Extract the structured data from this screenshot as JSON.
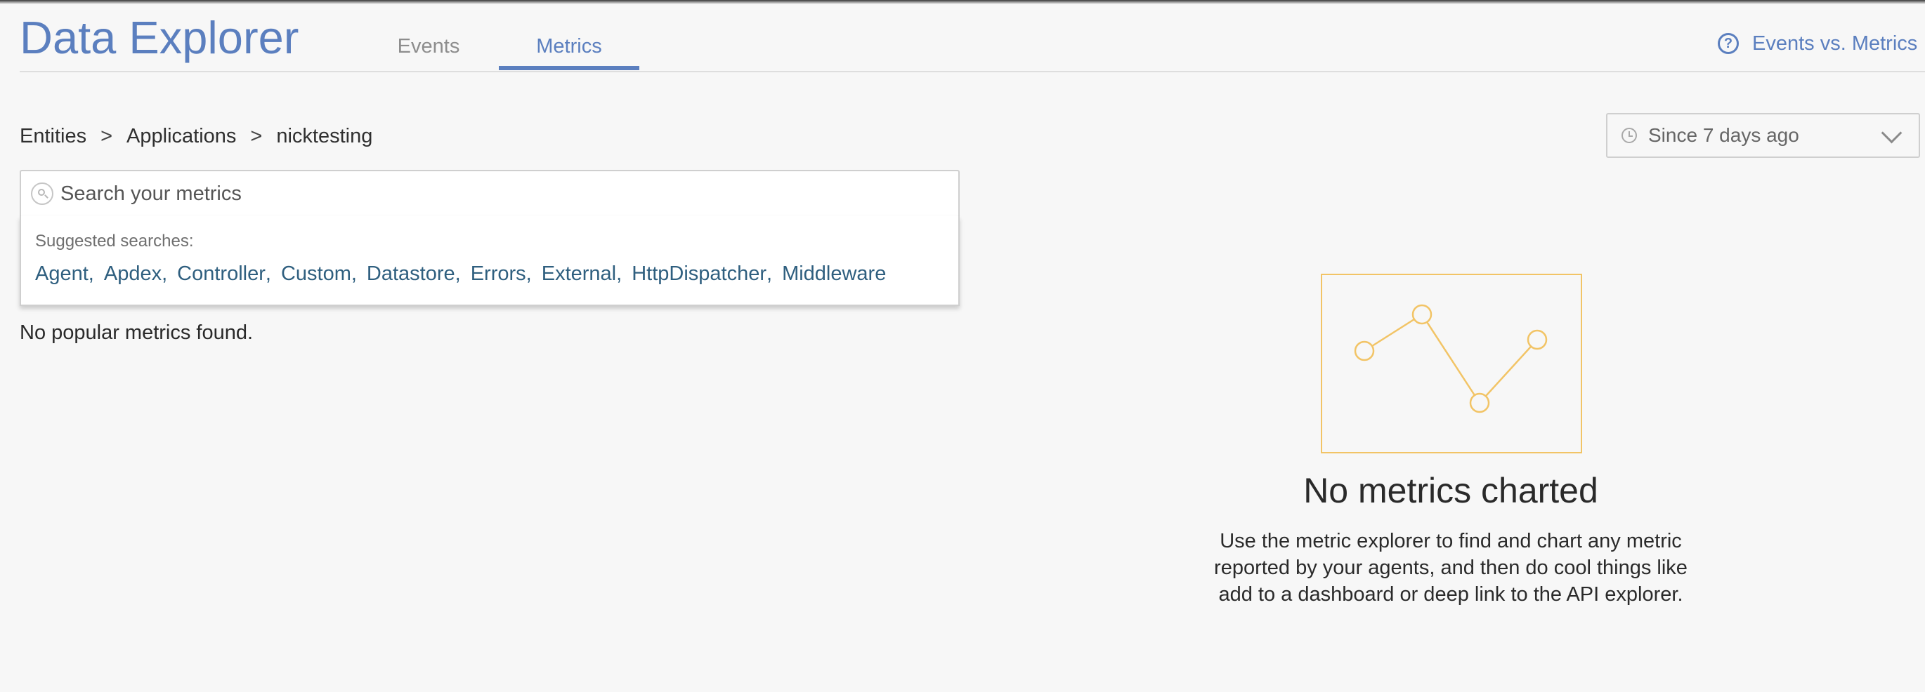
{
  "header": {
    "app_title": "Data Explorer",
    "tabs": [
      {
        "label": "Events",
        "active": false
      },
      {
        "label": "Metrics",
        "active": true
      }
    ],
    "help_link": {
      "label": "Events vs. Metrics",
      "icon": "help-circle-icon"
    }
  },
  "breadcrumb": {
    "items": [
      "Entities",
      "Applications",
      "nicktesting"
    ],
    "separator": ">"
  },
  "time_picker": {
    "label": "Since 7 days ago",
    "icon": "clock-icon"
  },
  "search": {
    "placeholder": "Search your metrics",
    "value": ""
  },
  "suggestions": {
    "heading": "Suggested searches:",
    "items": [
      "Agent",
      "Apdex",
      "Controller",
      "Custom",
      "Datastore",
      "Errors",
      "External",
      "HttpDispatcher",
      "Middleware"
    ],
    "separator": ","
  },
  "popular": {
    "message": "No popular metrics found."
  },
  "empty_state": {
    "title": "No metrics charted",
    "body": "Use the metric explorer to find and chart any metric reported by your agents, and then do cool things like add to a dashboard or deep link to the API explorer.",
    "illustration": "line-chart-placeholder-icon"
  },
  "colors": {
    "accent": "#5b7fbf",
    "link": "#2f5f7f",
    "illustration": "#f2c466",
    "background": "#f7f7f7"
  }
}
